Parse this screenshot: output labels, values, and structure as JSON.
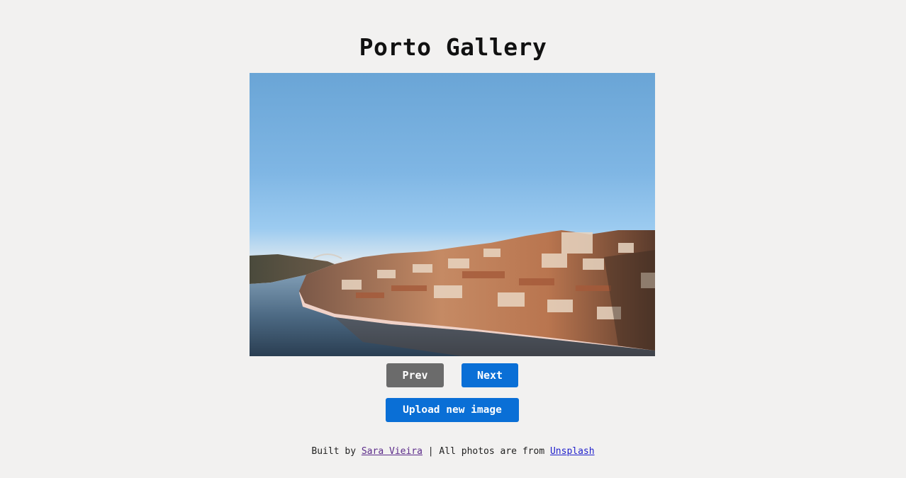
{
  "header": {
    "title": "Porto Gallery"
  },
  "gallery": {
    "image_alt": "Porto riverside city view at sunset"
  },
  "controls": {
    "prev_label": "Prev",
    "next_label": "Next",
    "upload_label": "Upload new image"
  },
  "footer": {
    "built_by_text": "Built by ",
    "author_name": "Sara Vieira",
    "separator_text": " | All photos are from ",
    "source_name": "Unsplash"
  },
  "colors": {
    "background": "#f2f1f0",
    "primary_button": "#0a6fd6",
    "disabled_button": "#6b6b6b"
  }
}
